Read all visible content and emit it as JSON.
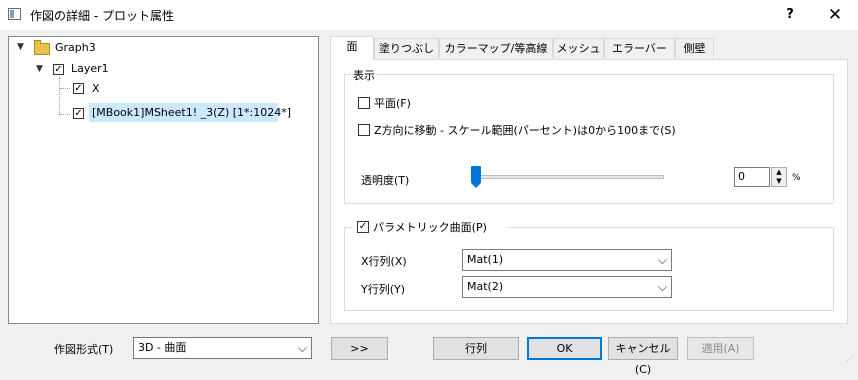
{
  "window": {
    "title": "作図の詳細 - プロット属性",
    "help": "?",
    "close": "✕"
  },
  "tree": {
    "graph": "Graph3",
    "layer": "Layer1",
    "item_x": "X",
    "item_data": "[MBook1]MSheet1! _3(Z) [1*:1024*]"
  },
  "tabs": [
    "面",
    "塗りつぶし",
    "カラーマップ/等高線",
    "メッシュ",
    "エラーバー",
    "側壁"
  ],
  "display": {
    "group_title": "表示",
    "flat_label": "平面(F)",
    "flat_checked": false,
    "zmove_label": "Z方向に移動 - スケール範囲(パーセント)は0から100まで(S)",
    "zmove_checked": false,
    "transparency_label": "透明度(T)",
    "transparency_value": "0",
    "transparency_unit": "%",
    "transparency_level": 0
  },
  "parametric": {
    "label": "パラメトリック曲面(P)",
    "checked": true,
    "x_matrix_label": "X行列(X)",
    "x_matrix_value": "Mat(1)",
    "y_matrix_label": "Y行列(Y)",
    "y_matrix_value": "Mat(2)"
  },
  "footer": {
    "plot_type_label": "作図形式(T)",
    "plot_type_value": "3D - 曲面",
    "expand_button": ">>",
    "matrix_button": "行列",
    "ok_button": "OK",
    "cancel_button": "キャンセル(C)",
    "apply_button": "適用(A)"
  }
}
